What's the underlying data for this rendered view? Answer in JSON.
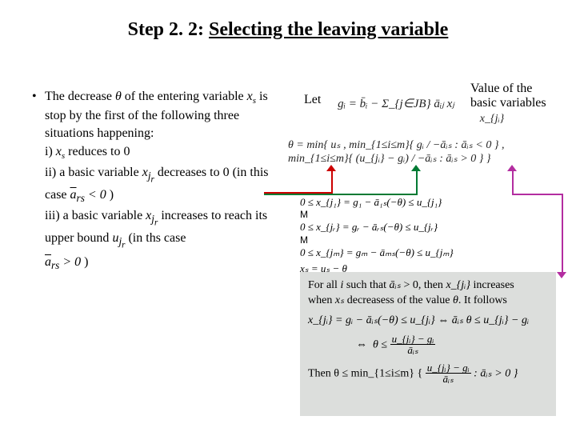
{
  "title_prefix": "Step 2. 2: ",
  "title_underlined": "Selecting the leaving variable",
  "left": {
    "lead1": "The decrease ",
    "theta": "θ",
    "lead2": " of the entering variable ",
    "xs": "x",
    "xs_sub": "s",
    "lead3": " is stop by the first of the following three situations happening:",
    "i_label": "i) ",
    "i_text": " reduces to 0",
    "ii_label": "ii) a basic variable ",
    "ii_var": "x",
    "ii_sub": "j",
    "ii_subr": "r",
    "ii_text": " decreases to 0 (in this case ",
    "ii_cond": "a",
    "ii_cond_bar": "‾",
    "ii_cond_sub": "rs",
    "ii_cond_tail": " < 0",
    "ii_close": " )",
    "iii_label": "iii) a basic variable ",
    "iii_text": " increases to reach its upper bound ",
    "iii_u": "u",
    "iii_sub": "j",
    "iii_subr": "r",
    "iii_text2": " (in ths case",
    "iii_cond": "a",
    "iii_cond_sub": "rs",
    "iii_cond_tail": " > 0",
    "iii_close": " )"
  },
  "let": "Let",
  "value_label_l1": "Value of the",
  "value_label_l2": "basic variables",
  "gi_text": "gᵢ = b̄ᵢ − Σ_{j∈JB} āᵢⱼ xⱼ",
  "xji_text": "x_{jᵢ}",
  "theta_eq": "θ = min{ uₛ ,  min_{1≤i≤m}{ gᵢ / −āᵢₛ : āᵢₛ < 0 } ,  min_{1≤i≤m}{ (u_{jᵢ} − gᵢ) / −āᵢₛ : āᵢₛ > 0 } }",
  "system": {
    "r1": "0 ≤ x_{j₁} = g₁ − ā₁ₛ(−θ) ≤ u_{j₁}",
    "m": "M",
    "r2": "0 ≤ x_{jᵣ} = gᵣ − āᵣₛ(−θ) ≤ u_{jᵣ}",
    "r3": "0 ≤ x_{jₘ} = gₘ − āₘₛ(−θ) ≤ u_{jₘ}",
    "r4": "xₛ = uₛ − θ"
  },
  "grey": {
    "l1a": "For all ",
    "l1i": "i",
    "l1b": " such that ",
    "l1c": " > 0, then ",
    "l1d": " increases",
    "l2a": "when ",
    "l2b": " decreasess of the value ",
    "l2c": ". It follows",
    "l3": "x_{jᵢ} = gᵢ − āᵢₛ(−θ) ≤ u_{jᵢ}   ⇔   āᵢₛ θ ≤ u_{jᵢ} − gᵢ",
    "l4": "⇔   θ ≤ (u_{jᵢ} − gᵢ) / āᵢₛ",
    "l5a": "Then  θ ≤  min_{1≤i≤m} { ",
    "l5b": " : āᵢₛ > 0 }",
    "frac_num": "u_{jᵢ} − gᵢ",
    "frac_den": "āᵢₛ",
    "ais": "āᵢₛ",
    "xji": "x_{jᵢ}",
    "xs": "xₛ",
    "theta": "θ"
  }
}
